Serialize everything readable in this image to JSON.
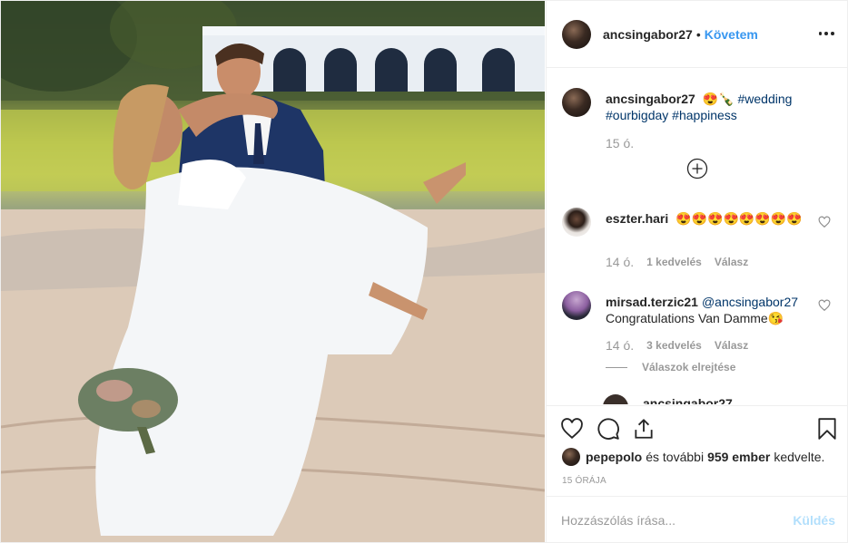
{
  "post": {
    "author": "ancsingabor27",
    "dot": "•",
    "follow_label": "Követem",
    "more_icon": "more-options-icon",
    "photo_description_icon": "wedding-photo"
  },
  "caption": {
    "username": "ancsingabor27",
    "emoji": "😍🍾",
    "hashtags": [
      "#wedding",
      "#ourbigday",
      "#happiness"
    ],
    "time": "15 ó."
  },
  "comments": [
    {
      "username": "eszter.hari",
      "text": "😍😍😍😍😍😍😍😍",
      "time": "14 ó.",
      "likes": "1 kedvelés",
      "reply": "Válasz"
    },
    {
      "username": "mirsad.terzic21",
      "mention": "@ancsingabor27",
      "text": "Congratulations Van Damme😘",
      "time": "14 ó.",
      "likes": "3 kedvelés",
      "reply": "Válasz",
      "hide_replies": "Válaszok elrejtése"
    }
  ],
  "partial_comment": {
    "username": "ancsingabor27"
  },
  "actions": {
    "like_icon": "heart-icon",
    "comment_icon": "comment-icon",
    "share_icon": "share-icon",
    "save_icon": "bookmark-icon"
  },
  "likes": {
    "first_user": "pepepolo",
    "connector": "és további",
    "count_text": "959 ember",
    "suffix": "kedvelte."
  },
  "timestamp": "15 ÓRÁJA",
  "add_comment": {
    "placeholder": "Hozzászólás írása...",
    "post_label": "Küldés"
  },
  "colors": {
    "link": "#3897f0",
    "hashtag": "#003569",
    "muted": "#999999",
    "post_disabled": "#b2dffc"
  }
}
